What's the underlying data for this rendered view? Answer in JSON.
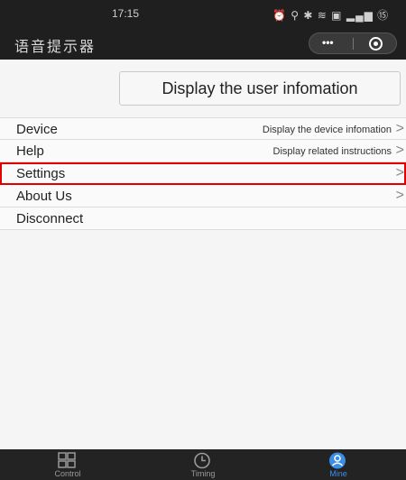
{
  "status_bar": {
    "time": "17:15",
    "icons_text": "⏰ ⚲ ✱ ≋ ▣ ▂▄▆ ⑮"
  },
  "nav": {
    "title": "语音提示器",
    "capsule_more": "•••"
  },
  "user_info_button": "Display the user infomation",
  "menu": [
    {
      "label": "Device",
      "desc": "Display the device infomation",
      "chevron": ">"
    },
    {
      "label": "Help",
      "desc": "Display related instructions",
      "chevron": ">"
    },
    {
      "label": "Settings",
      "desc": "",
      "chevron": ">"
    },
    {
      "label": "About Us",
      "desc": "",
      "chevron": ">"
    },
    {
      "label": "Disconnect",
      "desc": "",
      "chevron": ""
    }
  ],
  "tabs": [
    {
      "label": "Control",
      "icon": "grid-icon"
    },
    {
      "label": "Timing",
      "icon": "clock-icon"
    },
    {
      "label": "Mine",
      "icon": "user-icon",
      "active": true
    }
  ],
  "colors": {
    "highlight": "#e00000",
    "active_tab": "#3a8ee6",
    "dark_bar": "#1f1f1f"
  }
}
